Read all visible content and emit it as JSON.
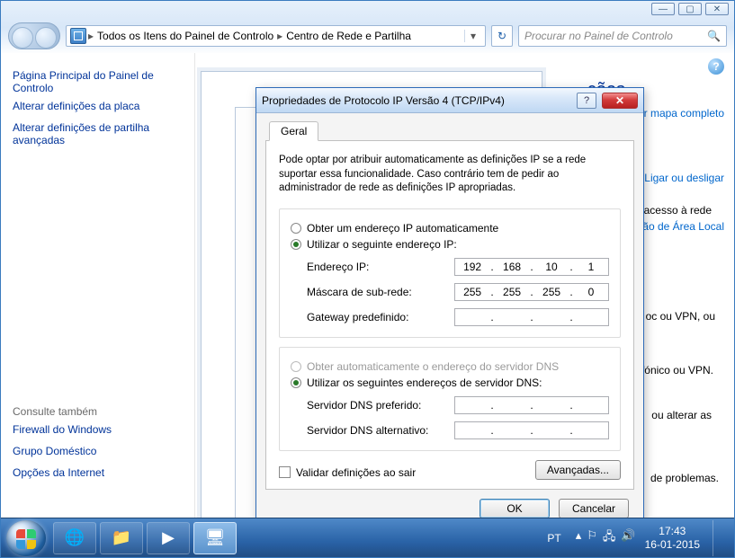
{
  "titlebar_buttons": {
    "min": "—",
    "max": "▢",
    "close": "✕"
  },
  "breadcrumb": {
    "root_label": "Todos os Itens do Painel de Controlo",
    "current": "Centro de Rede e Partilha"
  },
  "search": {
    "placeholder": "Procurar no Painel de Controlo"
  },
  "sidebar": {
    "title": "Página Principal do Painel de Controlo",
    "links": [
      "Alterar definições da placa",
      "Alterar definições de partilha avançadas"
    ],
    "see_also_title": "Consulte também",
    "see_also": [
      "Firewall do Windows",
      "Grupo Doméstico",
      "Opções da Internet"
    ]
  },
  "bg": {
    "heading_frag": "ções",
    "map_link": "Ver mapa completo",
    "connect_link": "Ligar ou desligar",
    "frag_access": "acesso à rede",
    "frag_local": "ão de Área Local",
    "frag_vpn1": "oc ou VPN, ou",
    "frag_vpn2": "fónico ou VPN.",
    "frag_alter": "ou alterar as",
    "frag_prob": "de problemas."
  },
  "dialog": {
    "title": "Propriedades de Protocolo IP Versão 4 (TCP/IPv4)",
    "help": "?",
    "close": "✕",
    "tab": "Geral",
    "desc": "Pode optar por atribuir automaticamente as definições IP se a rede suportar essa funcionalidade. Caso contrário tem de pedir ao administrador de rede as definições IP apropriadas.",
    "ip": {
      "auto": "Obter um endereço IP automaticamente",
      "manual": "Utilizar o seguinte endereço IP:",
      "addr_label": "Endereço IP:",
      "addr": [
        "192",
        "168",
        "10",
        "1"
      ],
      "mask_label": "Máscara de sub-rede:",
      "mask": [
        "255",
        "255",
        "255",
        "0"
      ],
      "gw_label": "Gateway predefinido:",
      "gw": [
        "",
        "",
        "",
        ""
      ]
    },
    "dns": {
      "auto": "Obter automaticamente o endereço do servidor DNS",
      "manual": "Utilizar os seguintes endereços de servidor DNS:",
      "pref_label": "Servidor DNS preferido:",
      "pref": [
        "",
        "",
        "",
        ""
      ],
      "alt_label": "Servidor DNS alternativo:",
      "alt": [
        "",
        "",
        "",
        ""
      ]
    },
    "validate": "Validar definições ao sair",
    "advanced": "Avançadas...",
    "ok": "OK",
    "cancel": "Cancelar"
  },
  "taskbar": {
    "lang": "PT",
    "time": "17:43",
    "date": "16-01-2015"
  }
}
